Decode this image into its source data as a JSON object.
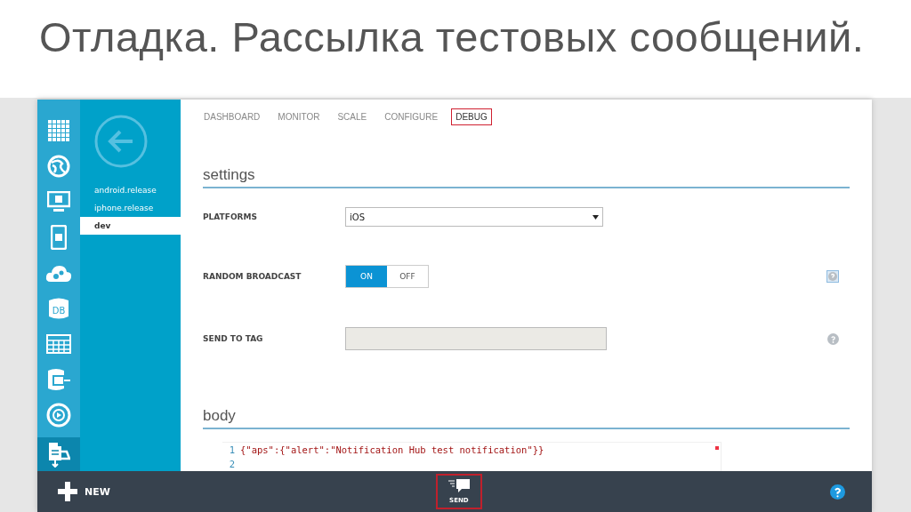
{
  "slide_title": "Отладка. Рассылка тестовых сообщений.",
  "rail_icons": [
    {
      "kind": "grid",
      "selected": false
    },
    {
      "kind": "globe",
      "selected": false
    },
    {
      "kind": "monitor",
      "selected": false
    },
    {
      "kind": "phone",
      "selected": false
    },
    {
      "kind": "cloud",
      "selected": false
    },
    {
      "kind": "db",
      "label": "DB",
      "selected": false
    },
    {
      "kind": "table",
      "selected": false
    },
    {
      "kind": "storage",
      "selected": false
    },
    {
      "kind": "media",
      "selected": false
    },
    {
      "kind": "hub",
      "selected": true
    }
  ],
  "hubs": [
    {
      "label": "android.release",
      "selected": false
    },
    {
      "label": "iphone.release",
      "selected": false
    },
    {
      "label": "dev",
      "selected": true
    }
  ],
  "tabs": [
    {
      "label": "DASHBOARD",
      "selected": false,
      "highlighted": false
    },
    {
      "label": "MONITOR",
      "selected": false,
      "highlighted": false
    },
    {
      "label": "SCALE",
      "selected": false,
      "highlighted": false
    },
    {
      "label": "CONFIGURE",
      "selected": false,
      "highlighted": false
    },
    {
      "label": "DEBUG",
      "selected": true,
      "highlighted": true
    }
  ],
  "settings_heading": "settings",
  "fields": [
    {
      "kind": "select",
      "label": "PLATFORMS",
      "value": "iOS"
    },
    {
      "kind": "toggle",
      "label": "RANDOM BROADCAST",
      "options": [
        {
          "label": "ON",
          "selected": true
        },
        {
          "label": "OFF",
          "selected": false
        }
      ]
    },
    {
      "kind": "text",
      "label": "SEND TO TAG",
      "disabled": true
    }
  ],
  "body_heading": "body",
  "code_lines": [
    {
      "number": "1",
      "text": "{\"aps\":{\"alert\":\"Notification Hub test notification\"}}"
    },
    {
      "number": "2"
    }
  ],
  "command_bar": {
    "new_label": "NEW",
    "send_label": "SEND",
    "send_highlighted": true
  }
}
